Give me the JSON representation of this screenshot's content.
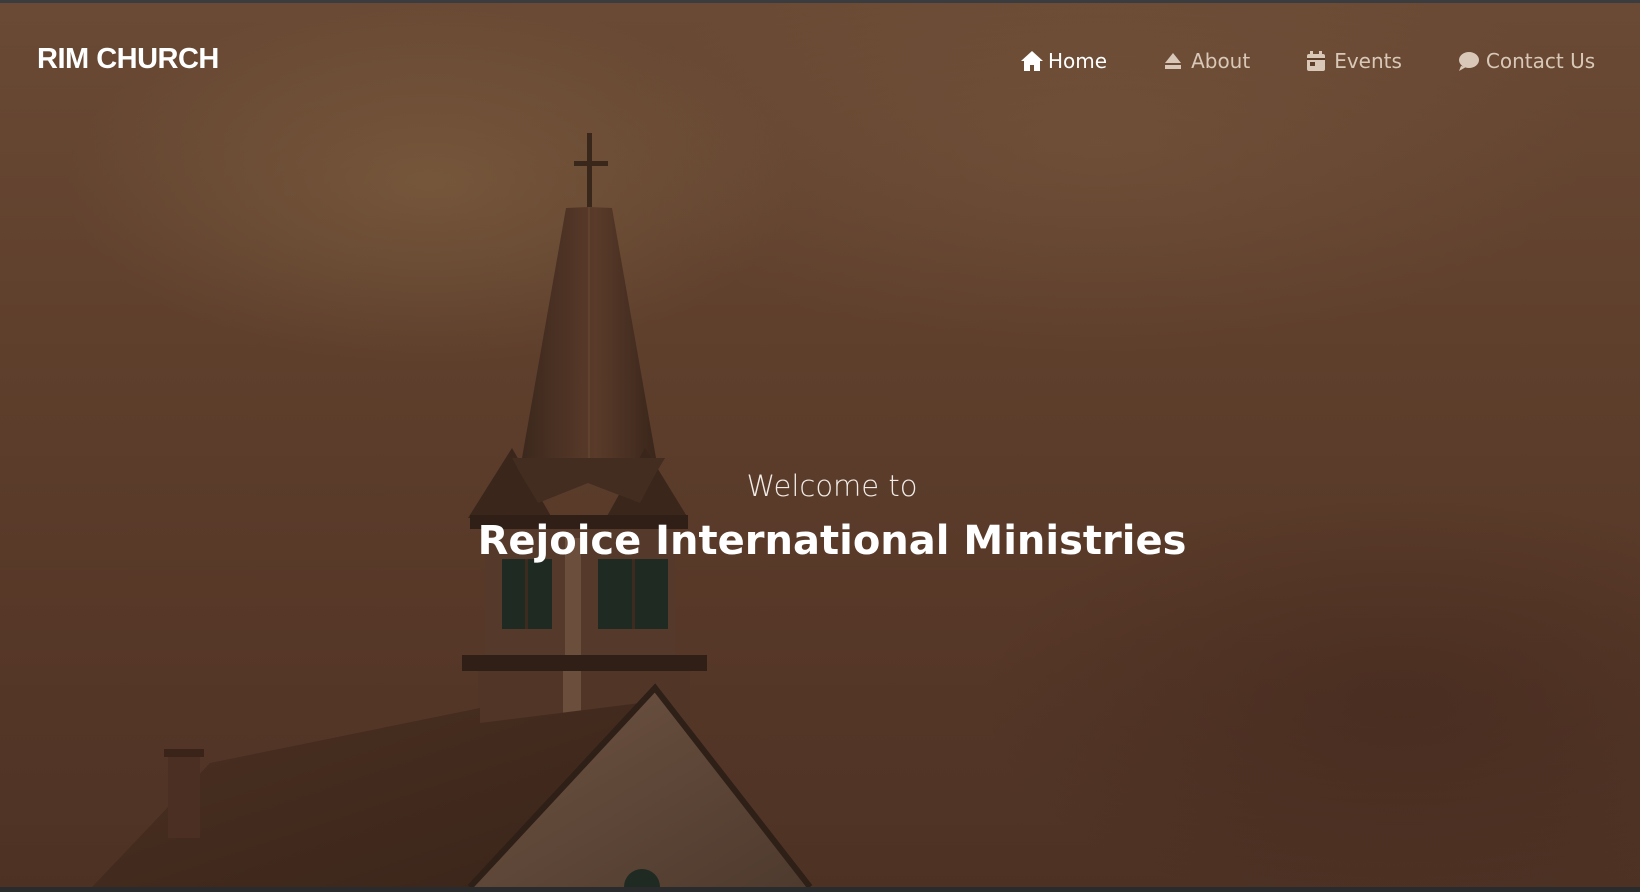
{
  "brand": {
    "name": "RIM CHURCH"
  },
  "nav": {
    "items": [
      {
        "label": "Home",
        "icon": "home-icon",
        "active": true
      },
      {
        "label": "About",
        "icon": "eject-icon",
        "active": false
      },
      {
        "label": "Events",
        "icon": "calendar-icon",
        "active": false
      },
      {
        "label": "Contact Us",
        "icon": "chat-bubble-icon",
        "active": false
      }
    ]
  },
  "hero": {
    "welcome": "Welcome to",
    "title": "Rejoice International Ministries",
    "image": "church-steeple-image"
  },
  "colors": {
    "overlay": "#5e3f2c",
    "text": "#ffffff",
    "nav_inactive": "#d9c8b8"
  }
}
